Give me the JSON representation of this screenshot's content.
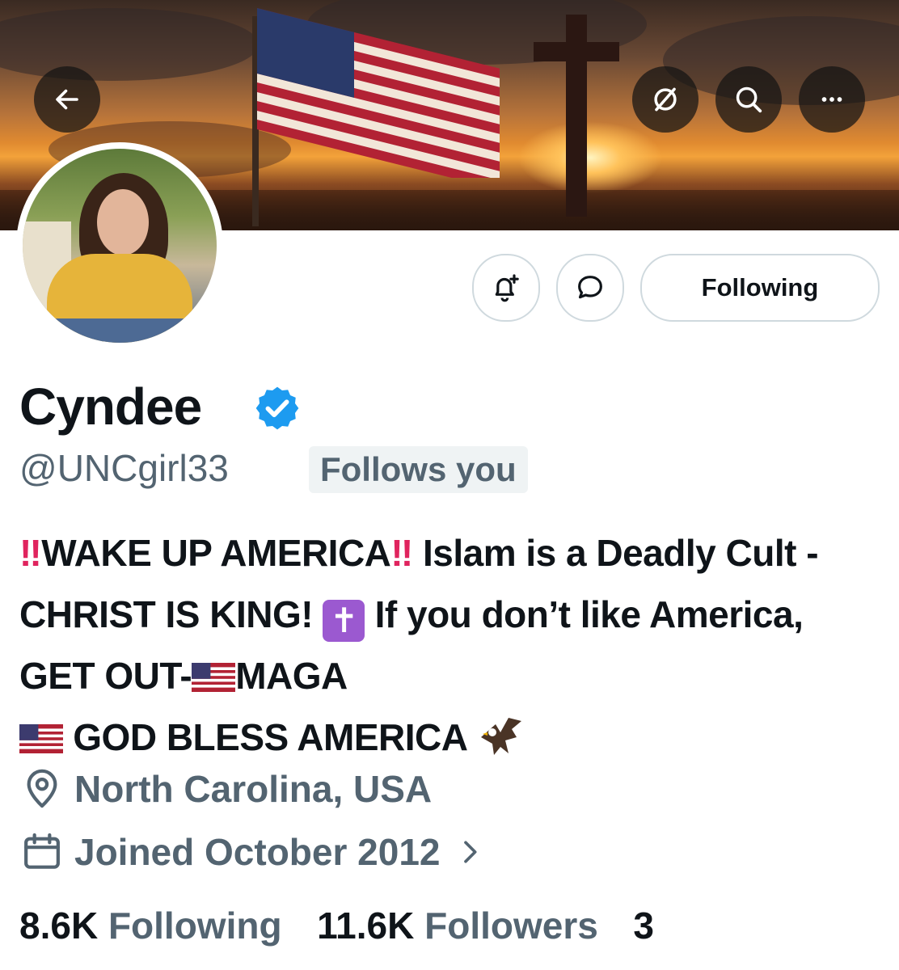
{
  "header": {
    "back_icon": "arrow-left-icon",
    "grok_icon": "slash-circle-icon",
    "search_icon": "search-icon",
    "more_icon": "more-horizontal-icon"
  },
  "profile": {
    "name": "Cyndee",
    "handle": "@UNCgirl33",
    "follows_you": "Follows you",
    "verified": true,
    "verified_color": "#1d9bf0",
    "bio": {
      "part1": "WAKE UP AMERICA",
      "part2": " Islam is a Deadly Cult - CHRIST IS KING! ",
      "part3": " If you don’t like America, GET OUT-",
      "part4": "MAGA ",
      "part5": " GOD BLESS AMERICA "
    },
    "location": "North Carolina, USA",
    "joined": "Joined October 2012",
    "stats": {
      "following_count": "8.6K",
      "following_label": "Following",
      "followers_count": "11.6K",
      "followers_label": "Followers",
      "subscriptions_count": "3"
    }
  },
  "actions": {
    "notify_icon": "bell-plus-icon",
    "message_icon": "message-bubble-icon",
    "following_label": "Following"
  },
  "colors": {
    "text_primary": "#0f1419",
    "text_secondary": "#536471",
    "border": "#cfd9de",
    "badge_bg": "#eff3f4",
    "bang": "#e0245e"
  }
}
